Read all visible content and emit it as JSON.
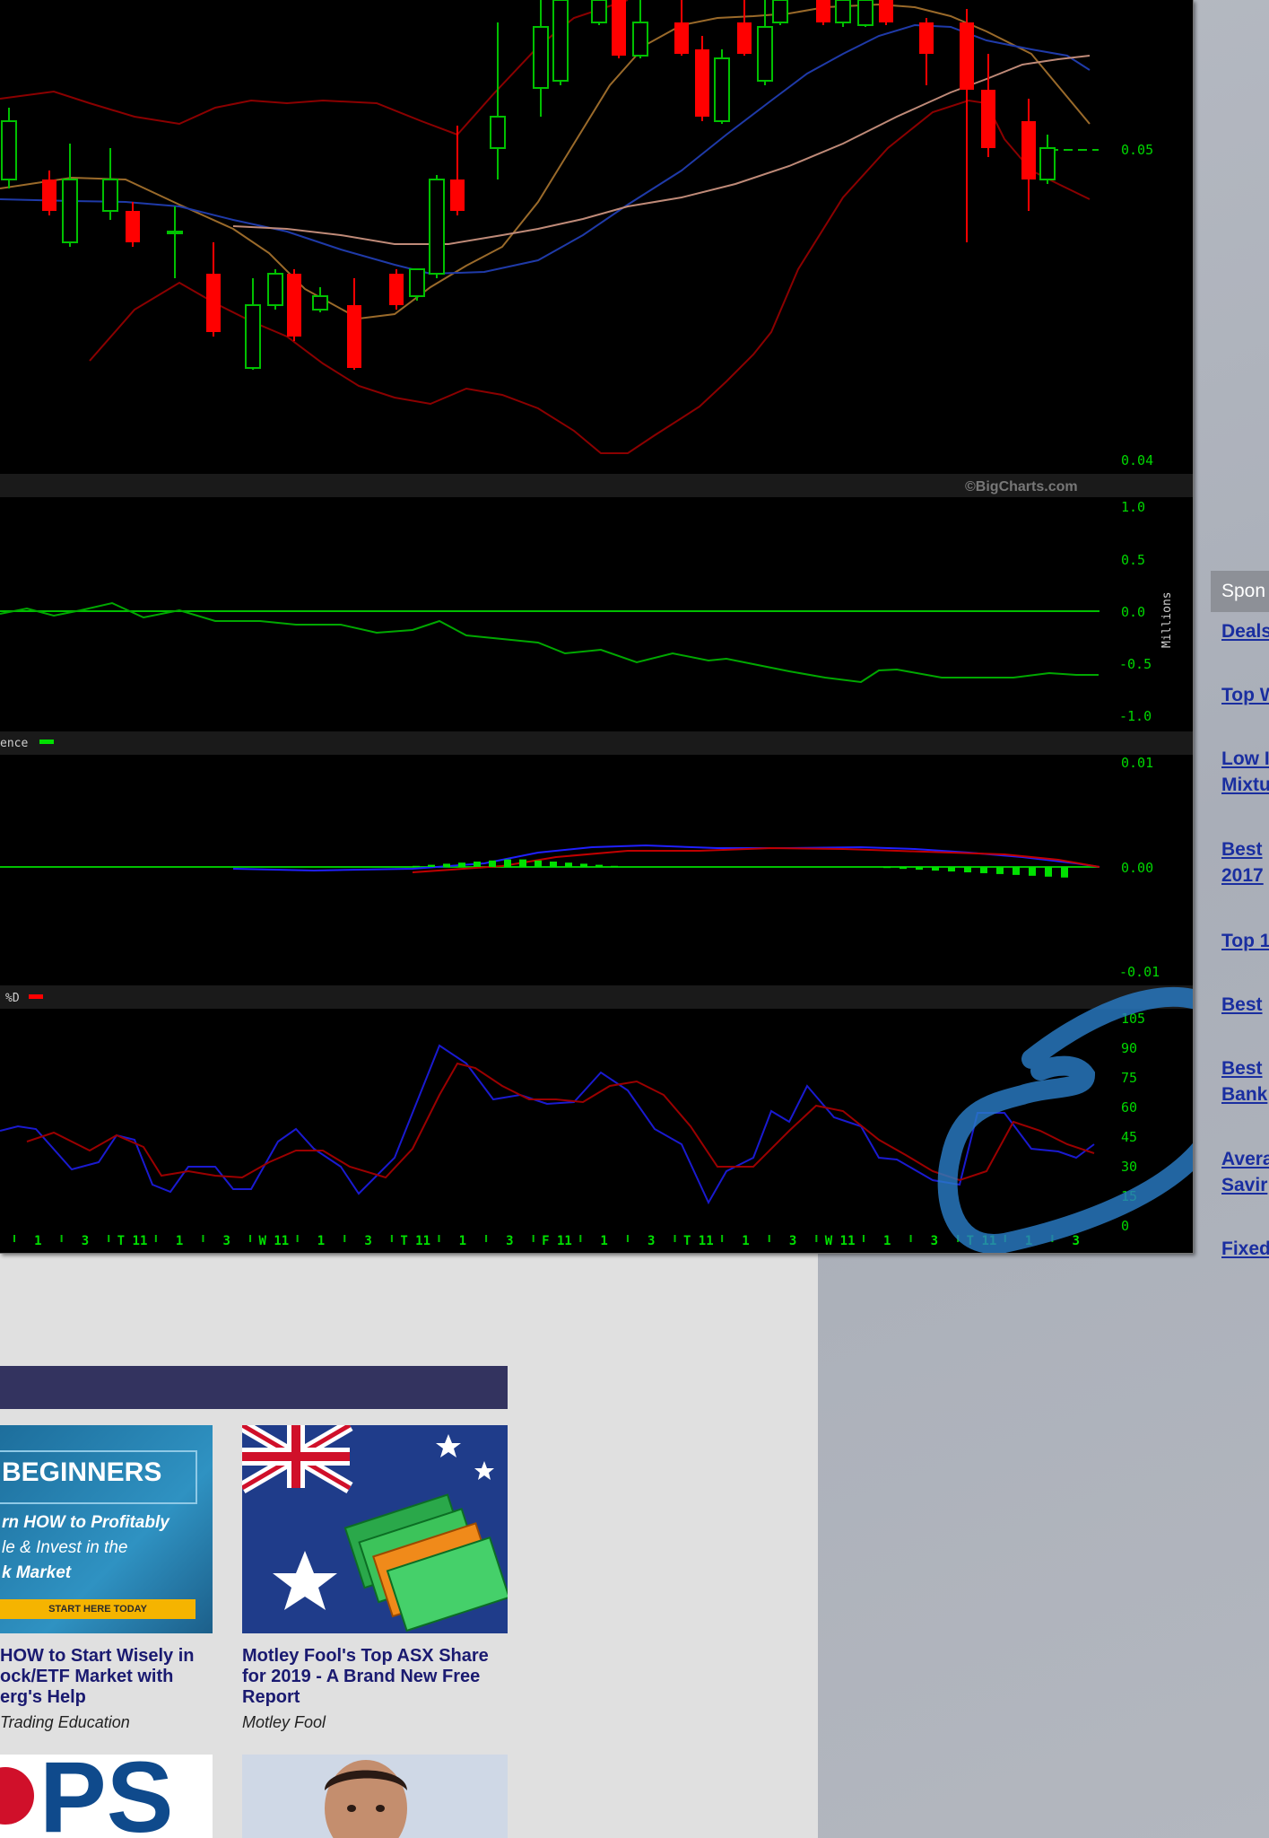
{
  "chart": {
    "credit": "©BigCharts.com",
    "price_panel": {
      "y_ticks": [
        "0.05",
        "0.04"
      ]
    },
    "volume_panel": {
      "y_ticks": [
        "1.0",
        "0.5",
        "0.0",
        "-0.5",
        "-1.0"
      ],
      "unit": "Millions"
    },
    "macd_panel": {
      "legend_fragment": "ence",
      "y_ticks": [
        "0.01",
        "0.00",
        "-0.01"
      ]
    },
    "stoch_panel": {
      "legend_fragment": "%D",
      "y_ticks": [
        "105",
        "90",
        "75",
        "60",
        "45",
        "30",
        "15",
        "0"
      ]
    },
    "date_ticks": [
      "1",
      "3",
      "T 11",
      "1",
      "3",
      "W 11",
      "1",
      "3",
      "T 11",
      "1",
      "3",
      "F 11",
      "1",
      "3",
      "T 11",
      "1",
      "3",
      "W 11",
      "1",
      "3",
      "T 11",
      "1",
      "3"
    ],
    "colors": {
      "up": "#00c000",
      "down": "#ff0000",
      "background": "#000000",
      "annotation": "#1e6fb8"
    }
  },
  "sponsored": {
    "header": "Spon",
    "links": [
      "Deals",
      "Top W",
      "Low I",
      "Mixtu",
      "Best",
      "2017",
      "Top 1",
      "Best",
      "Best",
      "Bank",
      "Avera",
      "Savir",
      "Fixed"
    ]
  },
  "recommended": {
    "cards": [
      {
        "image_text": {
          "headline": "BEGINNERS",
          "lines": [
            "rn HOW to Profitably",
            "le & Invest in the",
            "k Market"
          ],
          "cta": "START HERE TODAY"
        },
        "title_lines": [
          "HOW to Start Wisely in",
          "ock/ETF Market with",
          "erg's Help"
        ],
        "source": "Trading Education"
      },
      {
        "title_lines": [
          "Motley Fool's Top ASX Share",
          "for 2019 - A Brand New Free",
          "Report"
        ],
        "source": "Motley Fool"
      },
      {
        "image_text": {
          "logo": "PS"
        }
      },
      {}
    ]
  }
}
